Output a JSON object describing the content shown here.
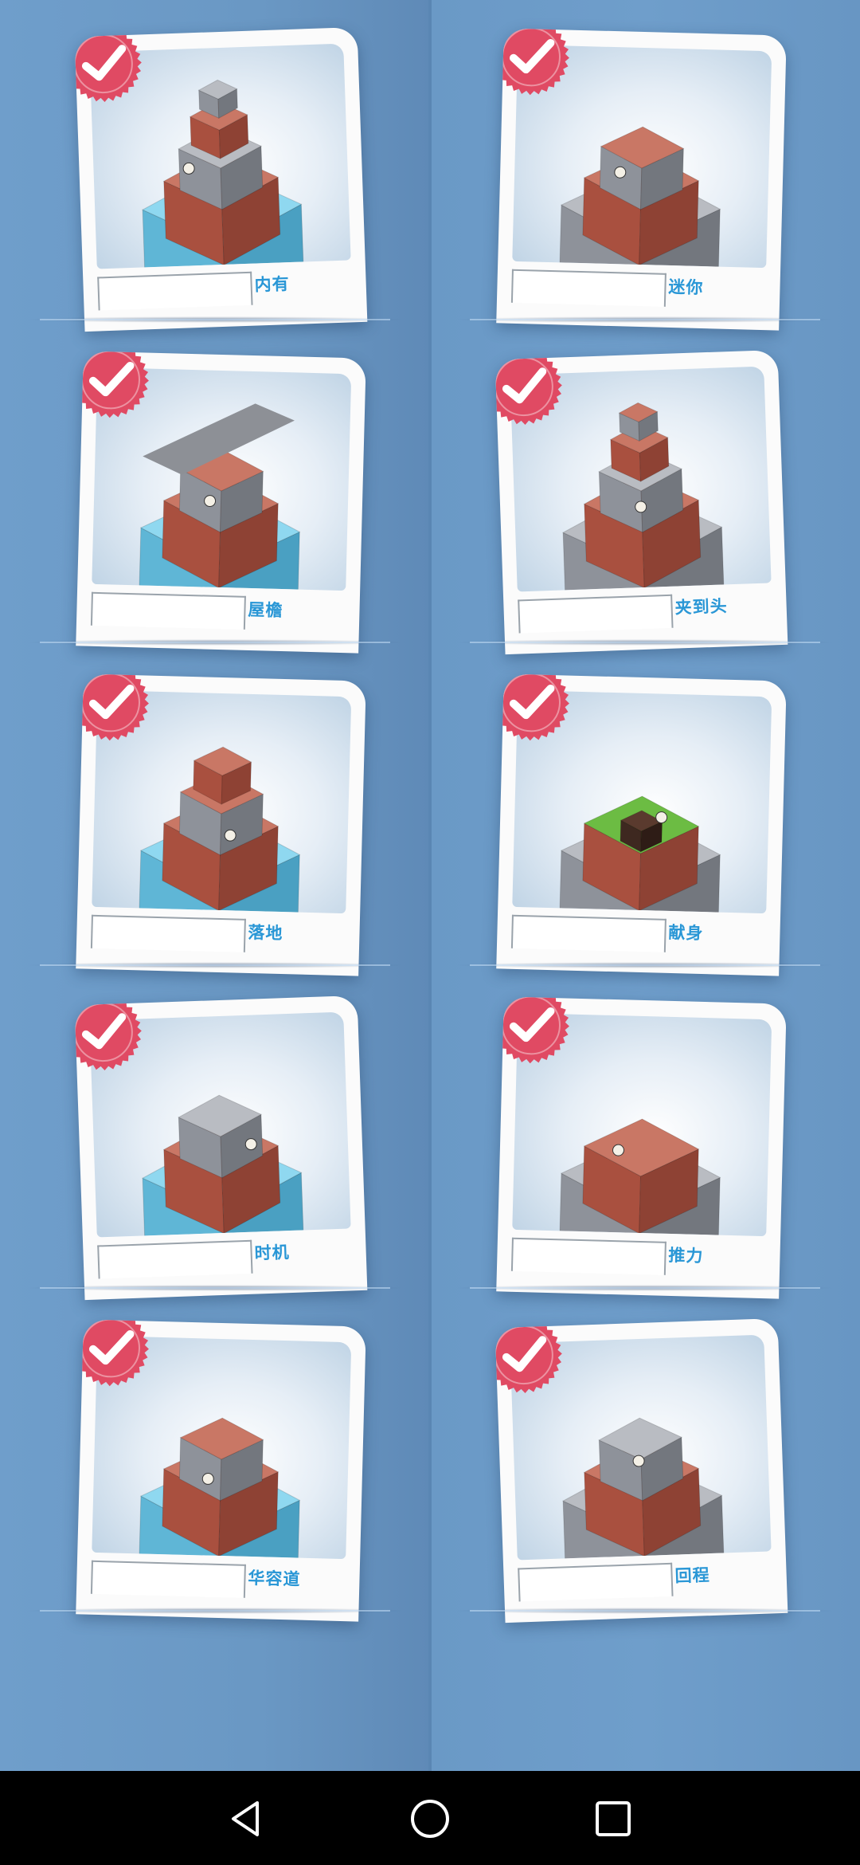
{
  "levels": [
    {
      "name": "内有",
      "completed": true
    },
    {
      "name": "迷你",
      "completed": true
    },
    {
      "name": "屋檐",
      "completed": true
    },
    {
      "name": "夹到头",
      "completed": true
    },
    {
      "name": "落地",
      "completed": true
    },
    {
      "name": "献身",
      "completed": true
    },
    {
      "name": "时机",
      "completed": true
    },
    {
      "name": "推力",
      "completed": true
    },
    {
      "name": "华容道",
      "completed": true
    },
    {
      "name": "回程",
      "completed": true
    }
  ],
  "icons": {
    "badge": "checkmark-seal-icon",
    "nav_back": "back-triangle-icon",
    "nav_home": "home-circle-icon",
    "nav_recent": "recent-square-icon"
  },
  "colors": {
    "background": "#6e9cc8",
    "badge": "#e04a63",
    "label": "#2a97d6",
    "brick": "#b8604e",
    "grass": "#5fa83a",
    "stone": "#9a9ea6",
    "water": "#7fd0ea"
  }
}
